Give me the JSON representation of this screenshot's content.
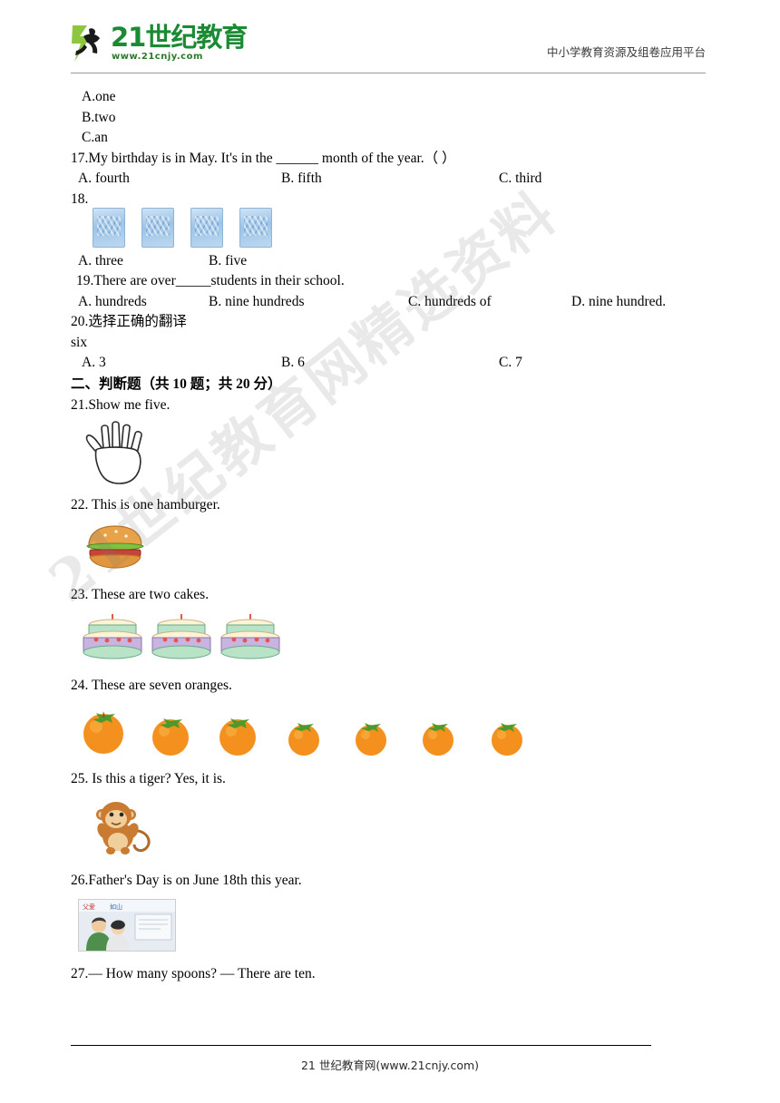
{
  "header": {
    "logo_line1": "21世纪教育",
    "logo_line2": "www.21cnjy.com",
    "slogan": "中小学教育资源及组卷应用平台"
  },
  "watermark": {
    "text": "21世纪教育网精选资料"
  },
  "questions": {
    "q16_options": [
      "A.one",
      "B.two",
      "C.an"
    ],
    "q17": {
      "stem": "17.My birthday is in May. It's in the ______ month of the year.（     ）",
      "options": [
        "A. fourth",
        "B. fifth",
        "C. third"
      ]
    },
    "q18": {
      "stem": "18.",
      "options": [
        "A. three",
        "B. five"
      ],
      "card_count": 4
    },
    "q19": {
      "stem": "19.There are over_____students in their school.",
      "options": [
        "A. hundreds",
        "B. nine hundreds",
        "C. hundreds of",
        "D. nine hundred."
      ]
    },
    "q20": {
      "stem": "20.选择正确的翻译",
      "sub": "six",
      "options": [
        "A. 3",
        "B. 6",
        "C. 7"
      ]
    },
    "section2_title": "二、判断题（共 10 题；共 20 分）",
    "q21": {
      "stem": "21.Show me five."
    },
    "q22": {
      "stem": "22. This is one hamburger."
    },
    "q23": {
      "stem": "23. These are two cakes.",
      "cake_count": 3
    },
    "q24": {
      "stem": "24. These are seven oranges.",
      "orange_count": 7
    },
    "q25": {
      "stem": "25. Is this a tiger? Yes, it is."
    },
    "q26": {
      "stem": "26.Father's Day is on June 18th this year."
    },
    "q27": {
      "stem": "27.— How many spoons? — There are ten."
    }
  },
  "footer": {
    "text": "21 世纪教育网(www.21cnjy.com)"
  },
  "colors": {
    "logo_green": "#1a8a33",
    "orange": "#f08a1c",
    "watermark": "rgba(120,120,120,0.16)"
  }
}
